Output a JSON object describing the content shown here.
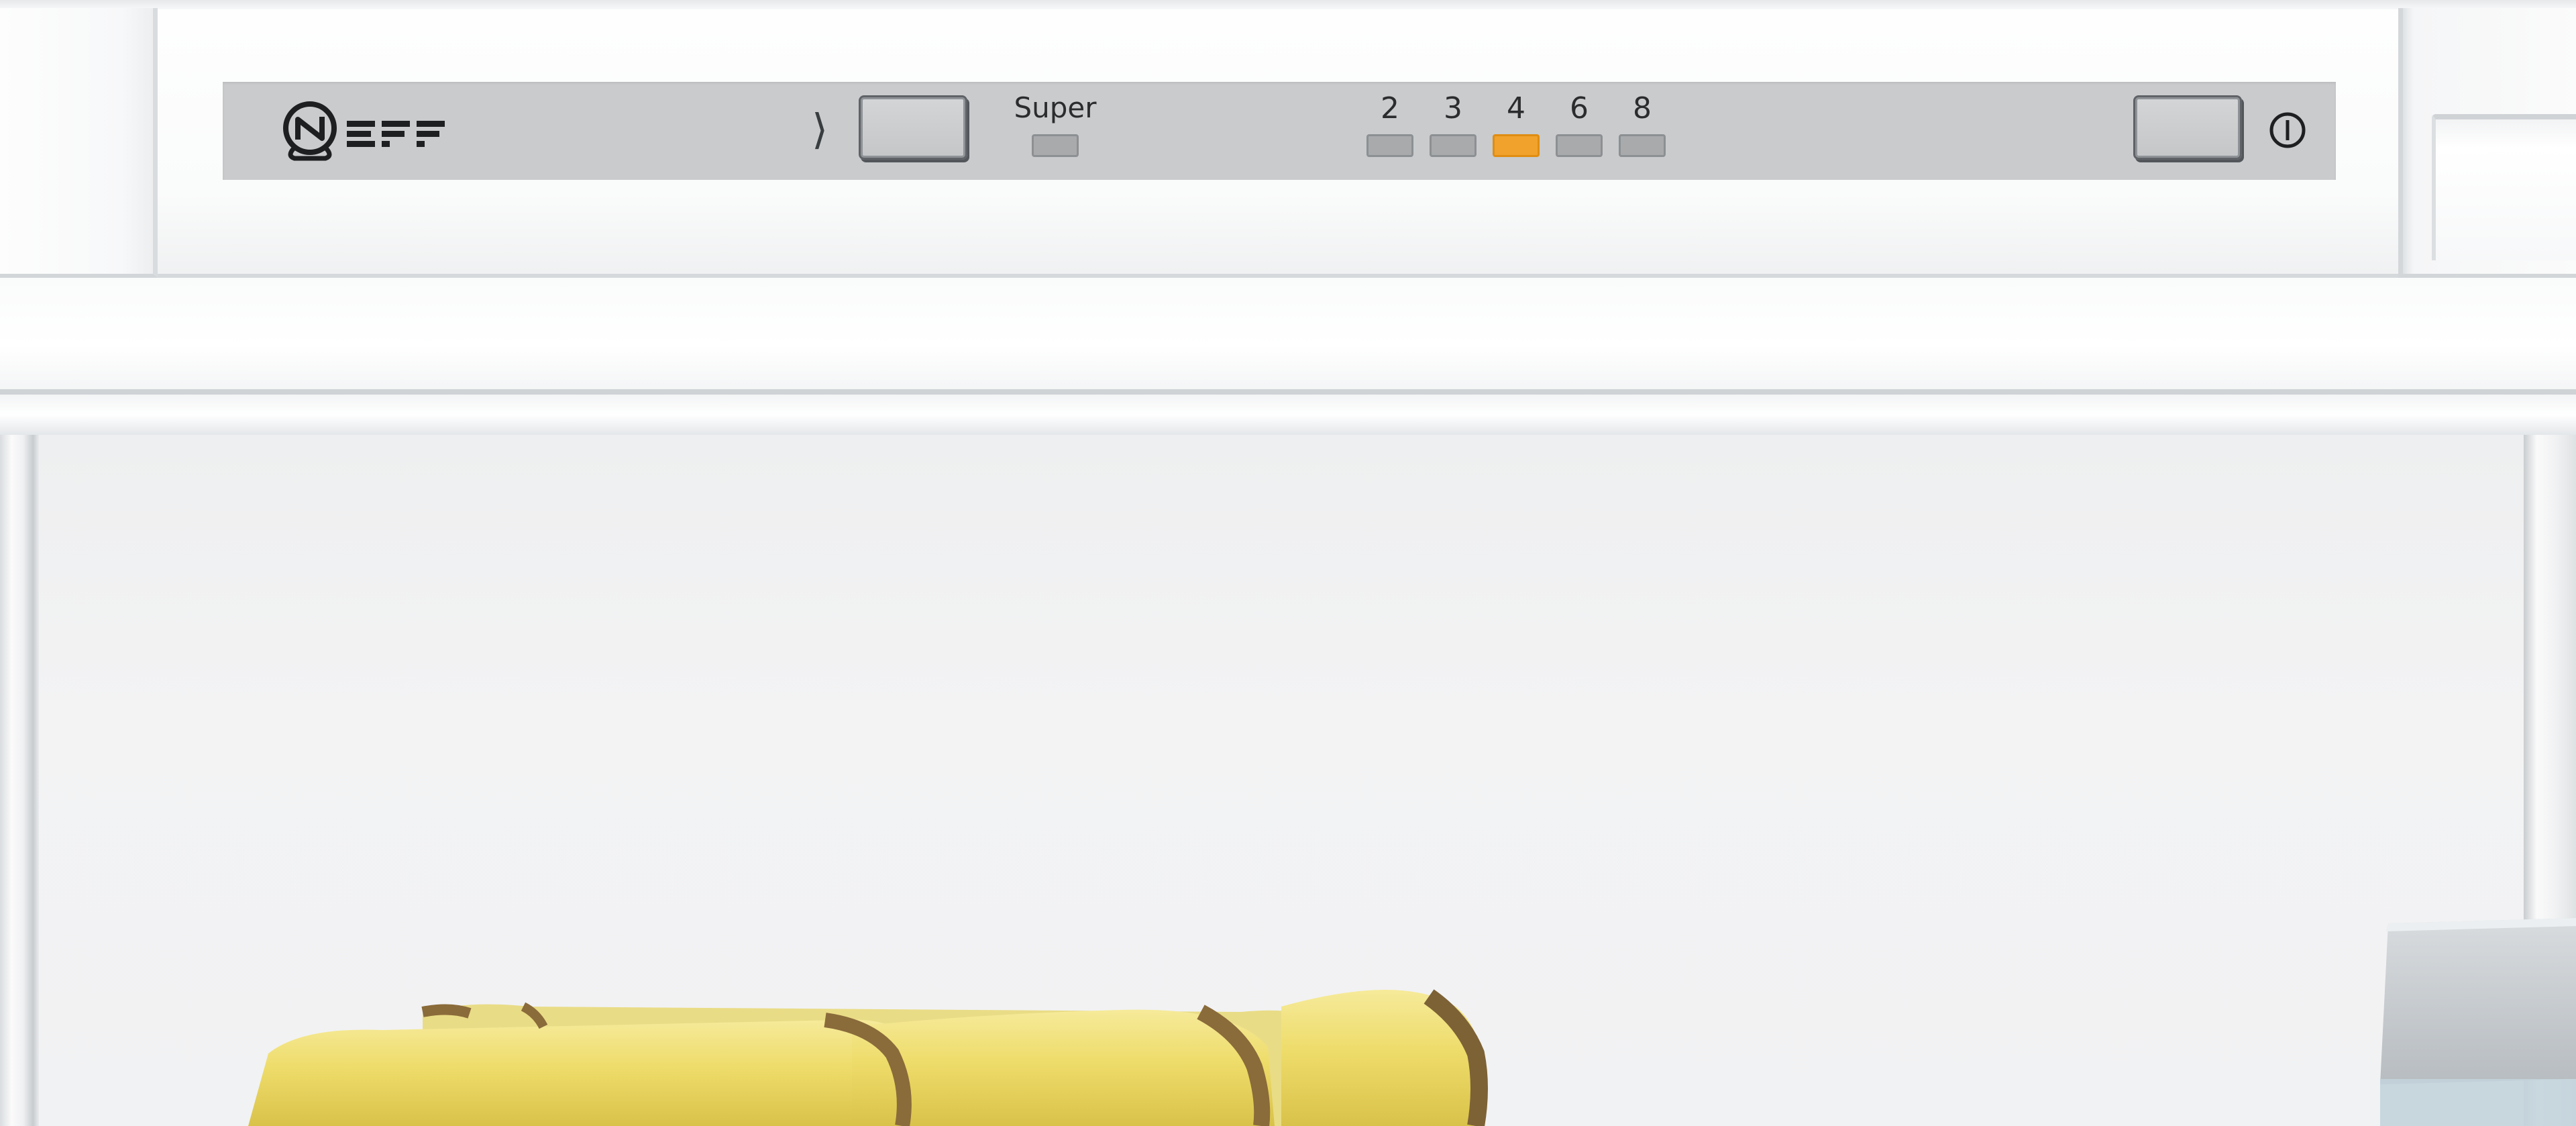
{
  "brand": {
    "name": "NEFF",
    "logo_icon": "neff-logo-icon"
  },
  "control_panel": {
    "mode_indicator_icon": "chevron-right-icon",
    "mode_button_icon": "mode-button",
    "super_label": "Super",
    "temperatures": [
      {
        "label": "2",
        "active": false
      },
      {
        "label": "3",
        "active": false
      },
      {
        "label": "4",
        "active": true
      },
      {
        "label": "6",
        "active": false
      },
      {
        "label": "8",
        "active": false
      }
    ],
    "power_icon": "power-icon",
    "colors": {
      "panel": "#c9cbcd",
      "led_inactive": "#a8aaac",
      "led_active": "#f0a22c"
    }
  }
}
